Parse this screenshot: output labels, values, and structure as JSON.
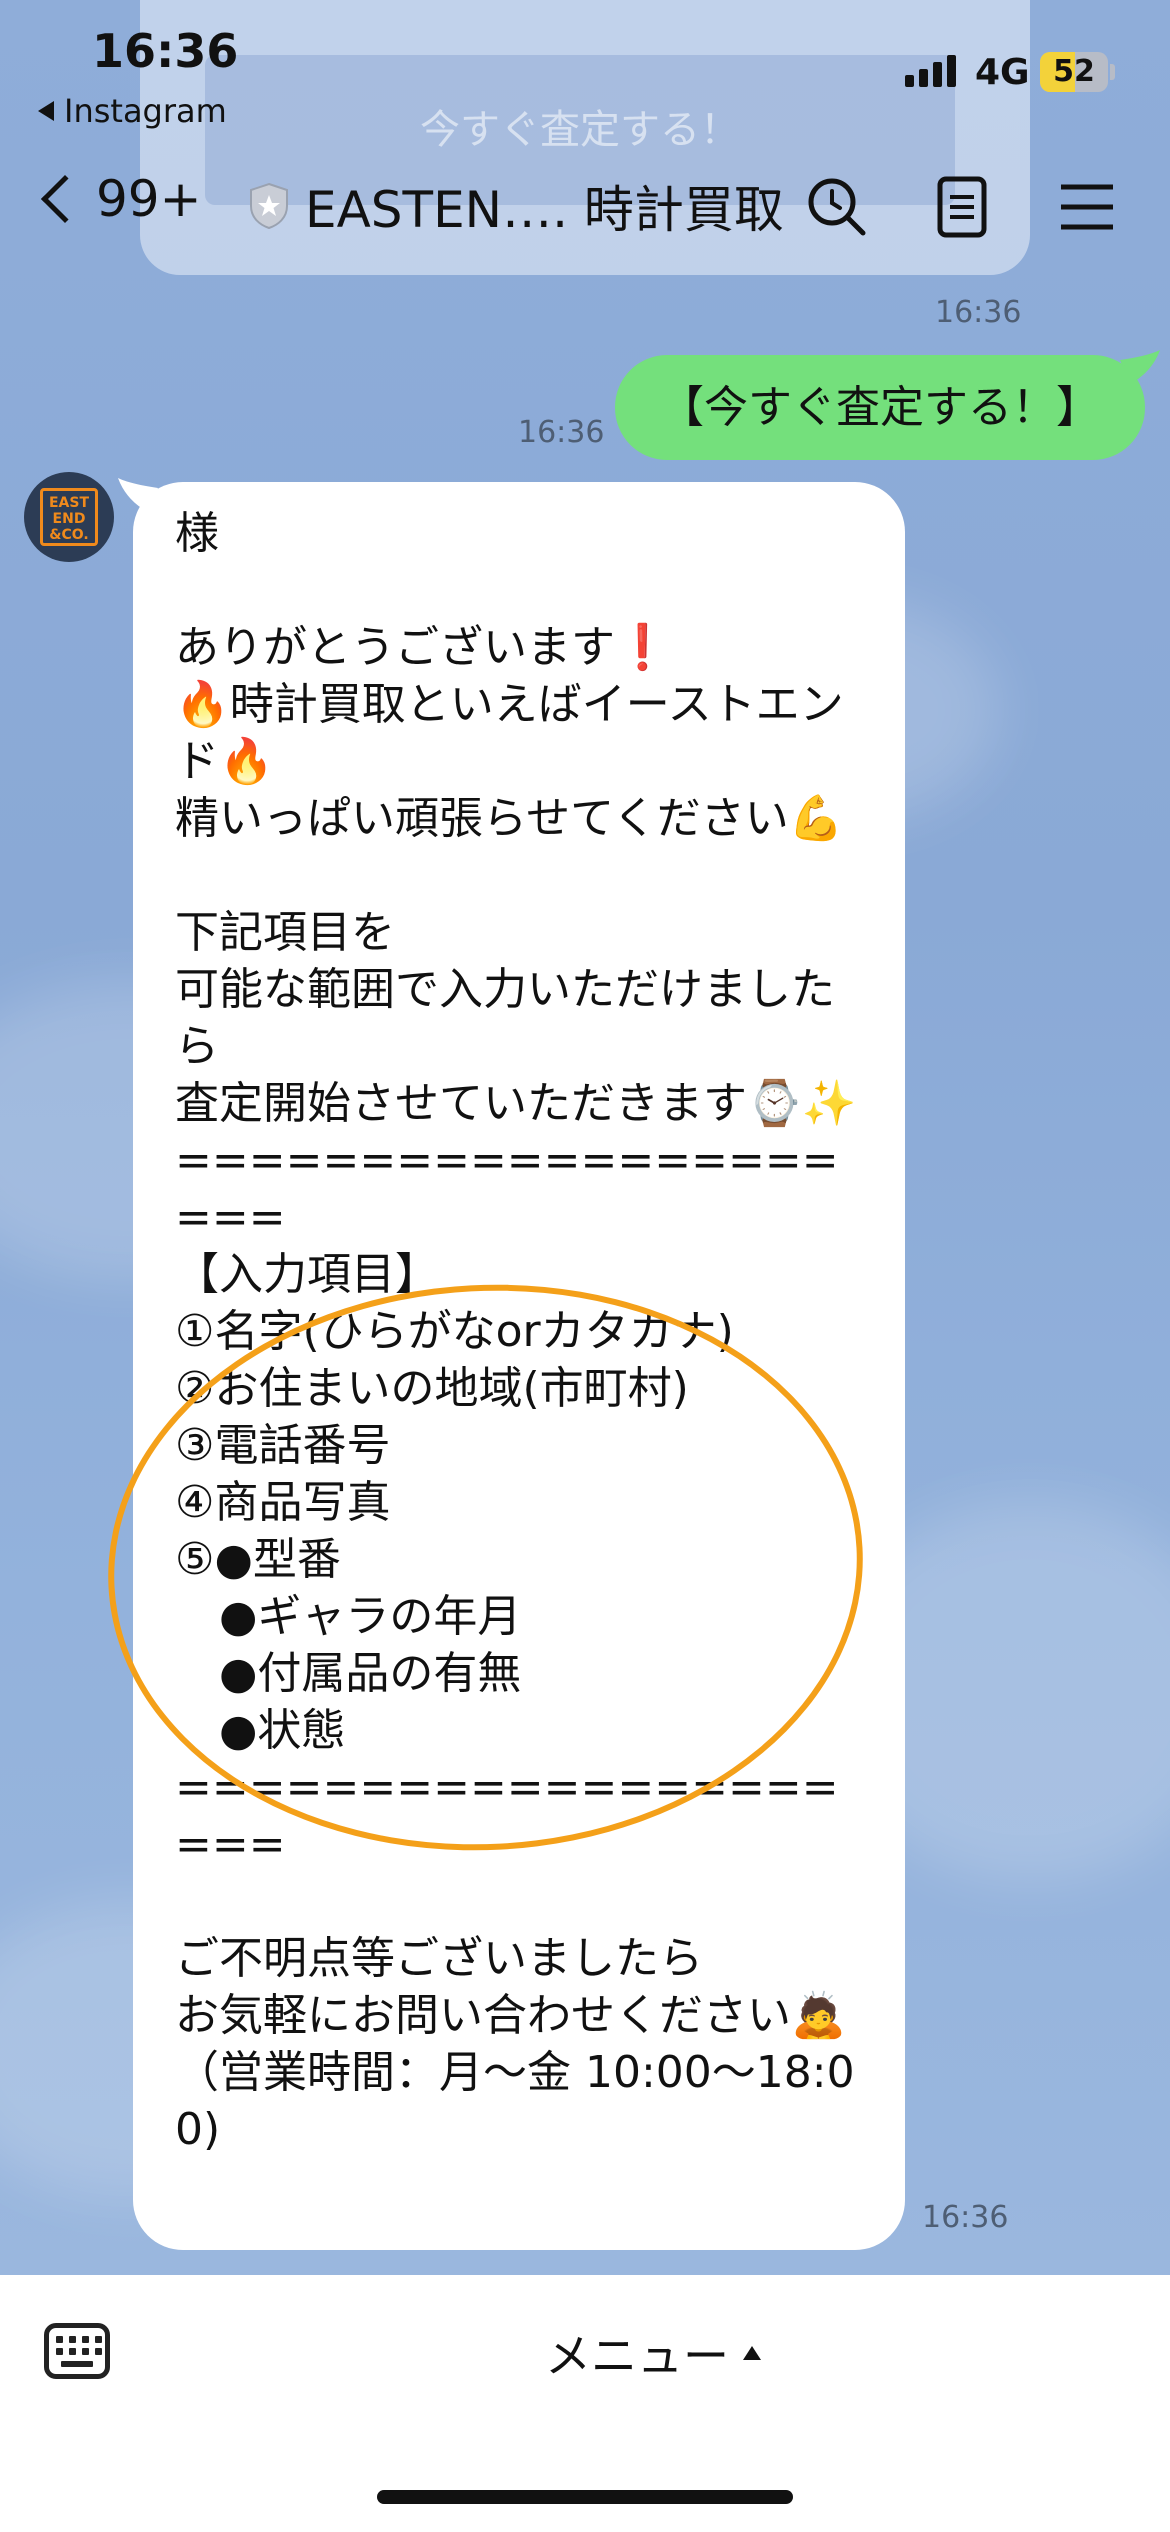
{
  "status_bar": {
    "time": "16:36",
    "back_app": "Instagram",
    "network": "4G",
    "battery": "52"
  },
  "header": {
    "back_count": "99+",
    "title": "EASTEN…. 時計買取",
    "icons": [
      "shield-icon",
      "search-icon",
      "notes-icon",
      "menu-icon"
    ]
  },
  "ghost_message": {
    "button_label": "今すぐ査定する！"
  },
  "messages": {
    "prev_time": "16:36",
    "sent": {
      "text": "【今すぐ査定する！】",
      "time": "16:36"
    },
    "received": {
      "avatar_text": "EAST END &CO.",
      "text": "様\n\nありがとうございます❗\n🔥時計買取といえばイーストエンド🔥\n精いっぱい頑張らせてください💪\n\n下記項目を\n可能な範囲で入力いただけましたら\n査定開始させていただきます⌚✨\n=====================\n【入力項目】\n①名字(ひらがなorカタカナ)\n②お住まいの地域(市町村)\n③電話番号\n④商品写真\n⑤●型番\n　●ギャラの年月\n　●付属品の有無\n　●状態\n=====================\n\nご不明点等ございましたら\nお気軽にお問い合わせください🙇\n（営業時間：月～金 10:00～18:00)",
      "time": "16:36"
    }
  },
  "bottom_bar": {
    "menu_label": "メニュー"
  },
  "colors": {
    "chat_background": "#8eacd8",
    "sent_bubble": "#74e07c",
    "received_bubble": "#ffffff",
    "annotation_circle": "#f4a019"
  }
}
